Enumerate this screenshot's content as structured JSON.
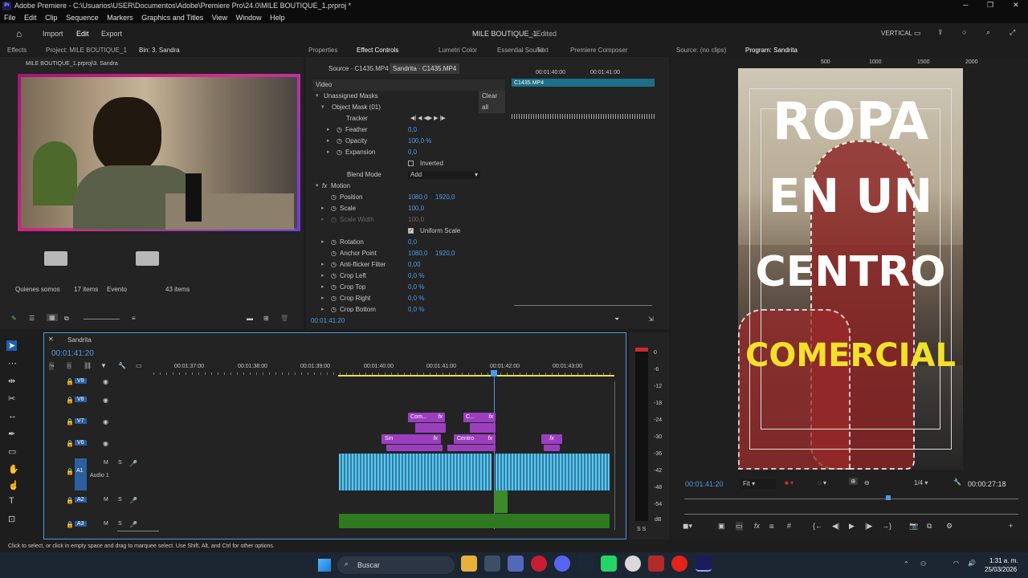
{
  "window": {
    "app_icon": "Pr",
    "title": "Adobe Premiere - C:\\Usuarios\\USER\\Documentos\\Adobe\\Premiere Pro\\24.0\\MILE BOUTIQUE_1.prproj *"
  },
  "menu": [
    "File",
    "Edit",
    "Clip",
    "Sequence",
    "Markers",
    "Graphics and Titles",
    "View",
    "Window",
    "Help"
  ],
  "workspace": {
    "import": "Import",
    "edit": "Edit",
    "export": "Export",
    "project_title": "MILE BOUTIQUE_1",
    "status": "- Edited",
    "layout": "VERTICAL"
  },
  "left_panel": {
    "tabs": [
      "Effects",
      "Project: MILE BOUTIQUE_1",
      "Bin: 3. Sandra"
    ],
    "path": "MILE BOUTIQUE_1.prproj\\3. Sandra",
    "bins": [
      {
        "name": "Quienes somos",
        "count": "17 items"
      },
      {
        "name": "Evento",
        "count": "43 items"
      }
    ]
  },
  "effect_controls": {
    "tabs": [
      "Properties",
      "Effect Controls",
      "Lumetri Color",
      "Essential Sound",
      "Text",
      "Premiere Composer"
    ],
    "source_tab": "Source · C1435.MP4",
    "clip_tab": "Sandrita · C1435.MP4",
    "ruler": [
      "00:01:40:00",
      "00:01:41:00"
    ],
    "clip_label": "C1435.MP4",
    "section": "Video",
    "unassigned": "Unassigned Masks",
    "clear_all": "Clear all",
    "mask": "Object Mask (01)",
    "tracker": "Tracker",
    "mask_props": [
      {
        "name": "Feather",
        "value": "0,0"
      },
      {
        "name": "Opacity",
        "value": "100,0 %"
      },
      {
        "name": "Expansion",
        "value": "0,0"
      }
    ],
    "inverted": "Inverted",
    "blend_label": "Blend Mode",
    "blend_value": "Add",
    "motion": "Motion",
    "position_label": "Position",
    "position_x": "1080,0",
    "position_y": "1920,0",
    "scale_label": "Scale",
    "scale_value": "100,0",
    "scale_width_label": "Scale Width",
    "scale_width_value": "100,0",
    "uniform": "Uniform Scale",
    "rotation_label": "Rotation",
    "rotation_value": "0,0",
    "anchor_label": "Anchor Point",
    "anchor_x": "1080,0",
    "anchor_y": "1920,0",
    "anti_label": "Anti-flicker Filter",
    "anti_value": "0,00",
    "crops": [
      {
        "name": "Crop Left",
        "value": "0,0 %"
      },
      {
        "name": "Crop Top",
        "value": "0,0 %"
      },
      {
        "name": "Crop Right",
        "value": "0,0 %"
      },
      {
        "name": "Crop Bottom",
        "value": "0,0 %"
      }
    ],
    "timecode": "00:01:41:20"
  },
  "source_monitor": {
    "tab": "Source: (no clips)"
  },
  "program": {
    "tab": "Program: Sandrita",
    "ruler": [
      "500",
      "1000",
      "1500",
      "2000"
    ],
    "timecode": "00:01:41:20",
    "fit": "Fit",
    "quality": "1/4",
    "duration": "00:00:27:18",
    "overlay_lines": [
      "ROPA",
      "EN UN",
      "CENTRO",
      "COMERCIAL"
    ],
    "colors": {
      "text_white": "#ffffff",
      "text_yellow": "#f2e12a",
      "mask_red": "#b31a1a"
    }
  },
  "timeline": {
    "seq": "Sandrita",
    "timecode": "00:01:41:20",
    "ruler": [
      "00:01:37:00",
      "00:01:38:00",
      "00:01:39:00",
      "00:01:40:00",
      "00:01:41:00",
      "00:01:42:00",
      "00:01:43:00"
    ],
    "tracks": [
      "V9",
      "V8",
      "V7",
      "V6",
      "A1",
      "A2",
      "A3"
    ],
    "audio1": "Audio 1",
    "clips": [
      {
        "label": "Com...",
        "fx": "fx"
      },
      {
        "label": "C...",
        "fx": "fx"
      },
      {
        "label": "Sin",
        "fx": "fx"
      },
      {
        "label": "Centro",
        "fx": "fx"
      },
      {
        "label": "fx",
        "fx": ""
      }
    ],
    "meter": [
      "0",
      "-6",
      "-12",
      "-18",
      "-24",
      "-30",
      "-36",
      "-42",
      "-48",
      "-54",
      "dB"
    ],
    "meter_footer": "S  S"
  },
  "status_bar": "Click to select, or click in empty space and drag to marquee select. Use Shift, Alt, and Ctrl for other options.",
  "taskbar": {
    "search": "Buscar",
    "time": "1:31 a. m.",
    "date": "25/03/2026"
  }
}
